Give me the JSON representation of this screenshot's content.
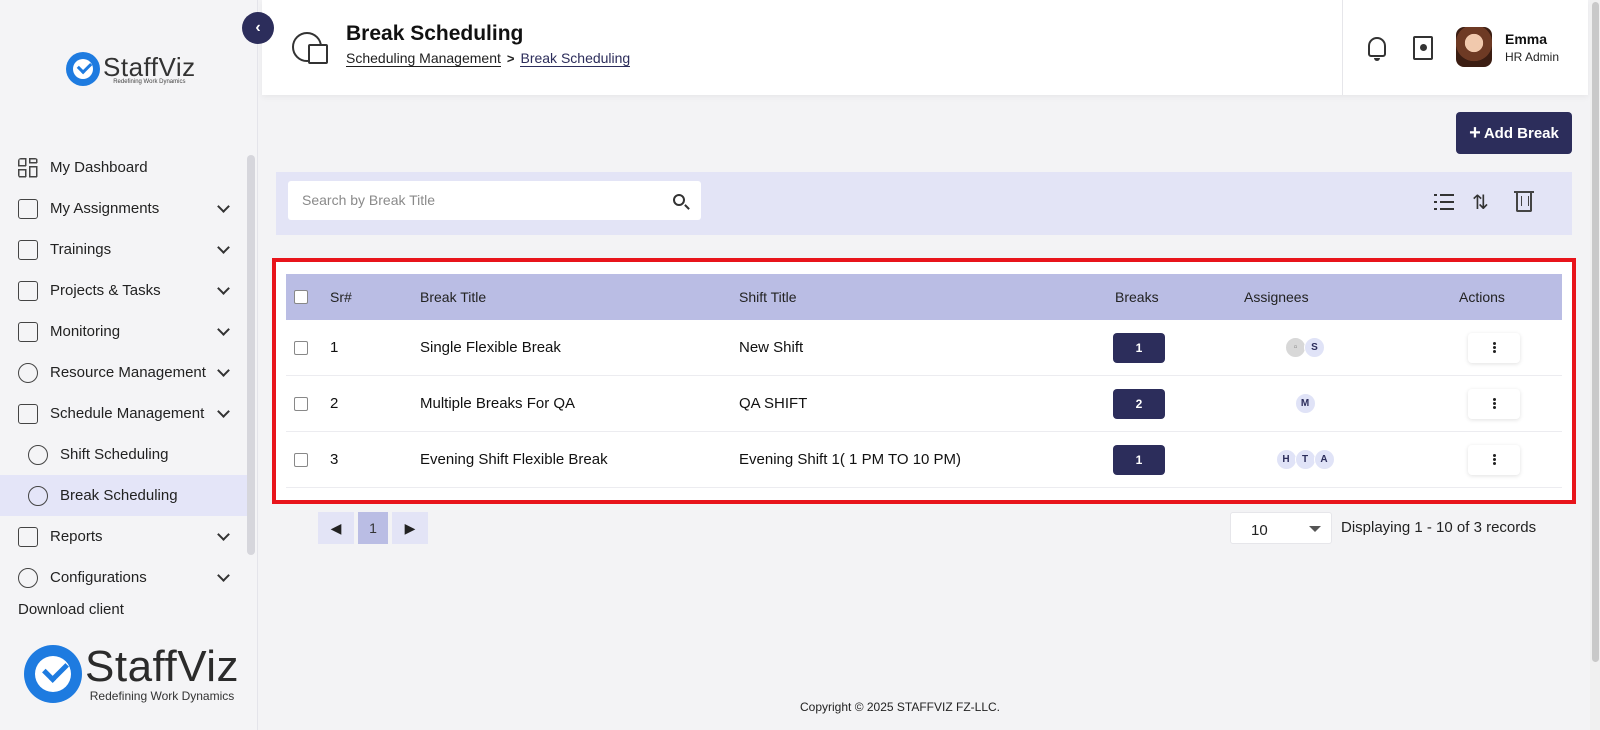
{
  "brand": {
    "name": "StaffViz",
    "tagline": "Redefining Work Dynamics"
  },
  "sidebar": {
    "items": [
      {
        "label": "My Dashboard",
        "icon": "dashboard-icon",
        "expandable": false
      },
      {
        "label": "My Assignments",
        "icon": "assignments-icon",
        "expandable": true
      },
      {
        "label": "Trainings",
        "icon": "trainings-icon",
        "expandable": true
      },
      {
        "label": "Projects & Tasks",
        "icon": "clipboard-icon",
        "expandable": true
      },
      {
        "label": "Monitoring",
        "icon": "monitoring-icon",
        "expandable": true
      },
      {
        "label": "Resource Management",
        "icon": "resource-icon",
        "expandable": true
      },
      {
        "label": "Schedule Management",
        "icon": "schedule-icon",
        "expandable": true
      },
      {
        "label": "Shift Scheduling",
        "icon": "shift-icon",
        "sub": true
      },
      {
        "label": "Break Scheduling",
        "icon": "break-icon",
        "sub": true,
        "active": true
      },
      {
        "label": "Reports",
        "icon": "reports-icon",
        "expandable": true
      },
      {
        "label": "Configurations",
        "icon": "config-icon",
        "expandable": true
      }
    ],
    "partial_item": "Download client"
  },
  "header": {
    "title": "Break Scheduling",
    "breadcrumb": [
      "Scheduling Management",
      "Break Scheduling"
    ],
    "user": {
      "name": "Emma",
      "role": "HR Admin"
    }
  },
  "actions": {
    "add_break": "Add Break"
  },
  "search": {
    "placeholder": "Search by Break Title"
  },
  "table": {
    "headers": {
      "sr": "Sr#",
      "title": "Break Title",
      "shift": "Shift Title",
      "breaks": "Breaks",
      "assignees": "Assignees",
      "actions": "Actions"
    },
    "rows": [
      {
        "sr": "1",
        "title": "Single Flexible Break",
        "shift": "New Shift",
        "breaks": "1",
        "assignees": [
          "img",
          "S"
        ]
      },
      {
        "sr": "2",
        "title": "Multiple Breaks For QA",
        "shift": "QA SHIFT",
        "breaks": "2",
        "assignees": [
          "M"
        ]
      },
      {
        "sr": "3",
        "title": "Evening Shift Flexible Break",
        "shift": "Evening Shift 1( 1 PM TO 10 PM)",
        "breaks": "1",
        "assignees": [
          "H",
          "T",
          "A"
        ]
      }
    ]
  },
  "pagination": {
    "prev": "◀",
    "current": "1",
    "next": "▶",
    "page_size": "10",
    "summary": "Displaying 1 - 10 of 3 records"
  },
  "footer": {
    "copyright": "Copyright © 2025 STAFFVIZ FZ-LLC."
  },
  "colors": {
    "primary": "#2c2d5b",
    "header_row": "#babde4",
    "toolbar_bg": "#e3e4f6",
    "highlight": "#e8141b",
    "brand_blue": "#1e7be0"
  }
}
